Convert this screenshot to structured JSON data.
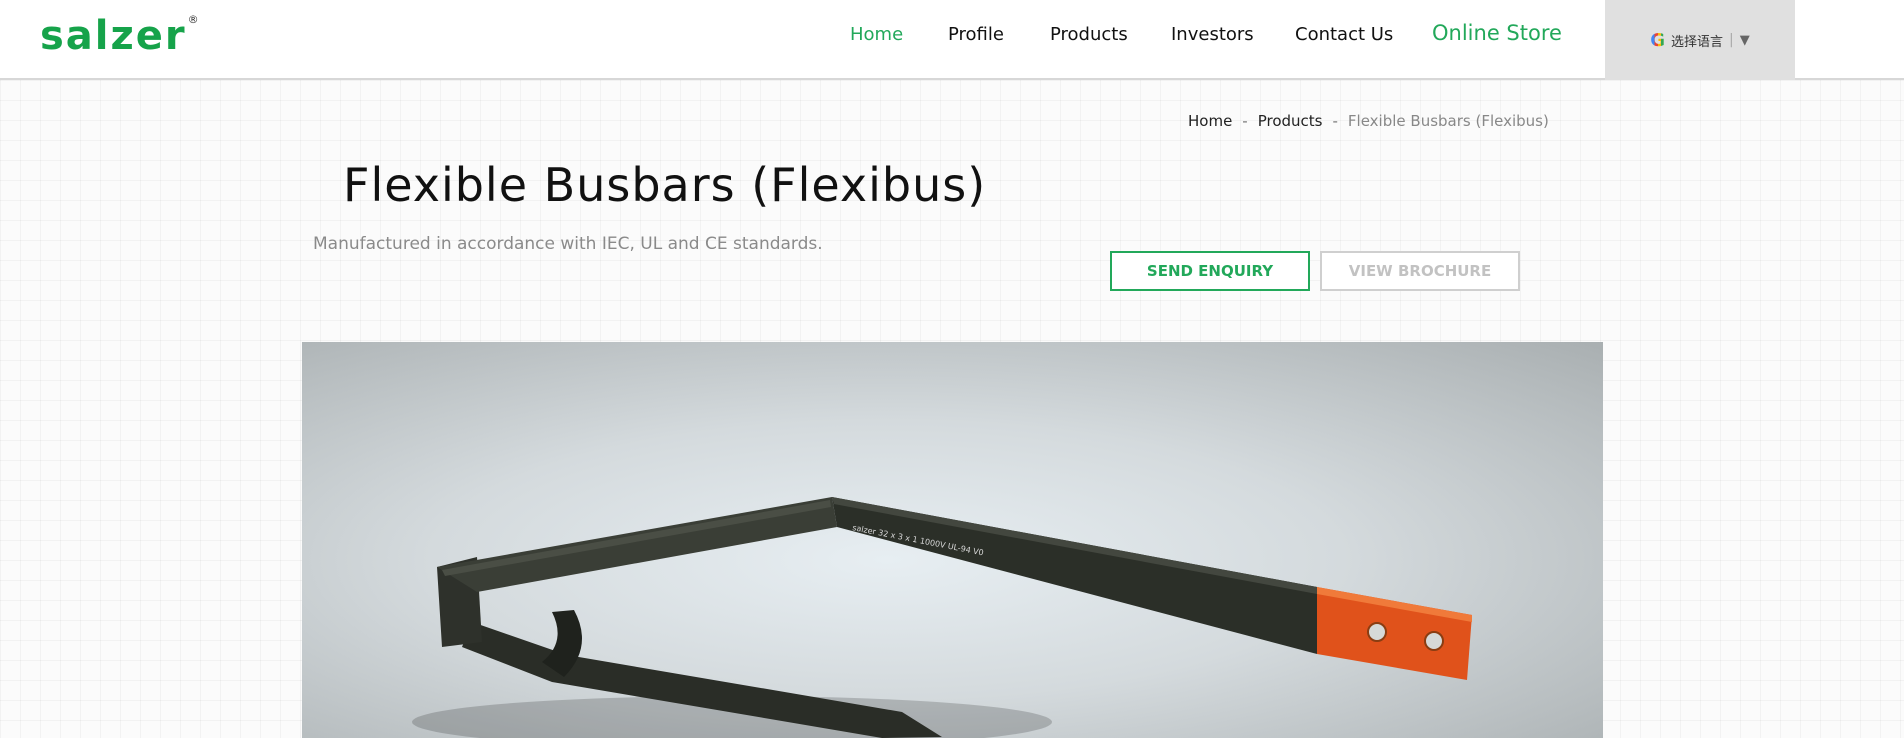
{
  "brand": {
    "logo_text": "salzer",
    "registered": "®"
  },
  "nav": {
    "items": [
      {
        "label": "Home",
        "active": true
      },
      {
        "label": "Profile"
      },
      {
        "label": "Products"
      },
      {
        "label": "Investors"
      },
      {
        "label": "Contact Us"
      },
      {
        "label": "Online Store"
      }
    ]
  },
  "language": {
    "label": "选择语言",
    "icon": "google-icon",
    "caret": "▼"
  },
  "breadcrumb": [
    "Home",
    "Products",
    "Flexible Busbars (Flexibus)"
  ],
  "page": {
    "title": "Flexible Busbars (Flexibus)",
    "subtitle": "Manufactured in accordance with IEC, UL and CE standards."
  },
  "buttons": {
    "enquiry": "SEND ENQUIRY",
    "brochure": "VIEW BROCHURE"
  },
  "product_image": {
    "imprint": "salzer 32 x 3 x 1 1000V UL-94 V0"
  },
  "colors": {
    "accent": "#22a85a",
    "nav_text": "#111111",
    "muted": "#8a8a8a"
  }
}
